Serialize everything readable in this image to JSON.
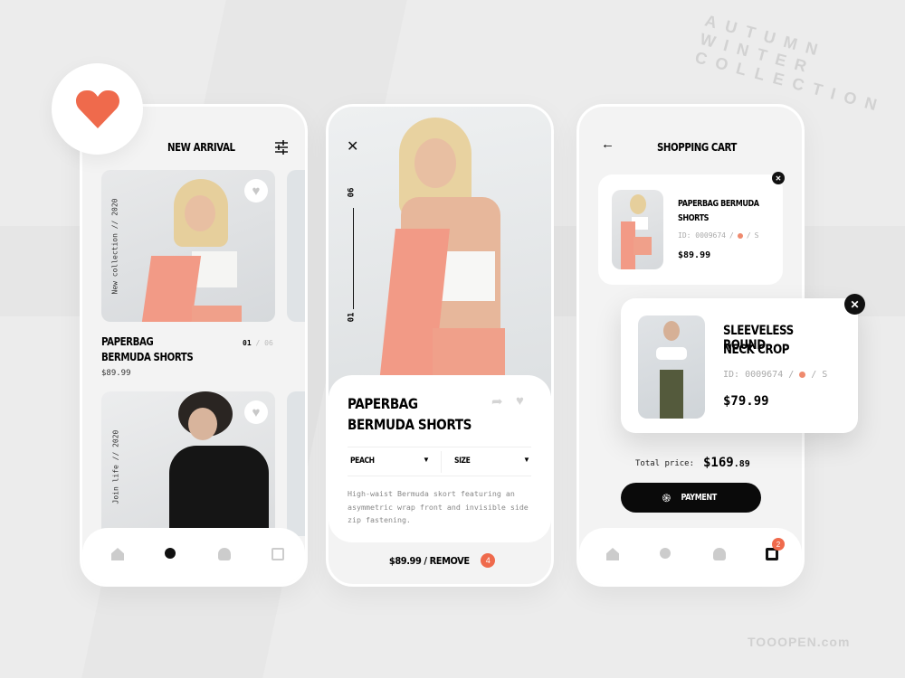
{
  "decor_text": "AUTUMN WINTER COLLECTION",
  "watermark": "TOOOPEN.com",
  "colors": {
    "accent": "#ef6a4c",
    "peach": "#f29a86",
    "dark": "#111111",
    "background": "#ececec"
  },
  "logo": {
    "icon": "heart-icon"
  },
  "screen1": {
    "title": "NEW ARRIVAL",
    "filter_icon": "sliders-icon",
    "products": [
      {
        "side_label": "New collection // 2020",
        "name_line1": "PAPERBAG",
        "name_line2": "BERMUDA SHORTS",
        "price": "$89.99",
        "page_current": "01",
        "page_sep": "/",
        "page_total": "06"
      },
      {
        "side_label": "Join life // 2020"
      }
    ],
    "nav": [
      "home-icon",
      "search-icon",
      "user-icon",
      "bag-icon"
    ],
    "nav_active": "search-icon"
  },
  "screen2": {
    "close_icon": "close-icon",
    "pager_top": "06",
    "pager_bottom": "01",
    "title_line1": "PAPERBAG",
    "title_line2": "BERMUDA SHORTS",
    "color_select": "PEACH",
    "size_select": "SIZE",
    "description": "High-waist Bermuda skort featuring an asymmetric wrap front and invisible side zip fastening.",
    "footer_label": "$89.99 / REMOVE",
    "badge": "4"
  },
  "screen3": {
    "title": "SHOPPING CART",
    "items": [
      {
        "name": "PAPERBAG BERMUDA SHORTS",
        "id": "ID: 0009674",
        "size": "S",
        "price": "$89.99",
        "color": "#ef8a6e"
      },
      {
        "name_line1": "SLEEVELESS ROUND",
        "name_line2": "NECK CROP",
        "id": "ID: 0009674",
        "size": "S",
        "price": "$79.99",
        "color": "#ef8a6e"
      }
    ],
    "total_label": "Total price:",
    "total_main": "$169",
    "total_cents": ".89",
    "payment_label": "PAYMENT",
    "cart_badge": "2",
    "nav": [
      "home-icon",
      "search-icon",
      "user-icon",
      "bag-icon"
    ],
    "nav_active": "bag-icon"
  }
}
